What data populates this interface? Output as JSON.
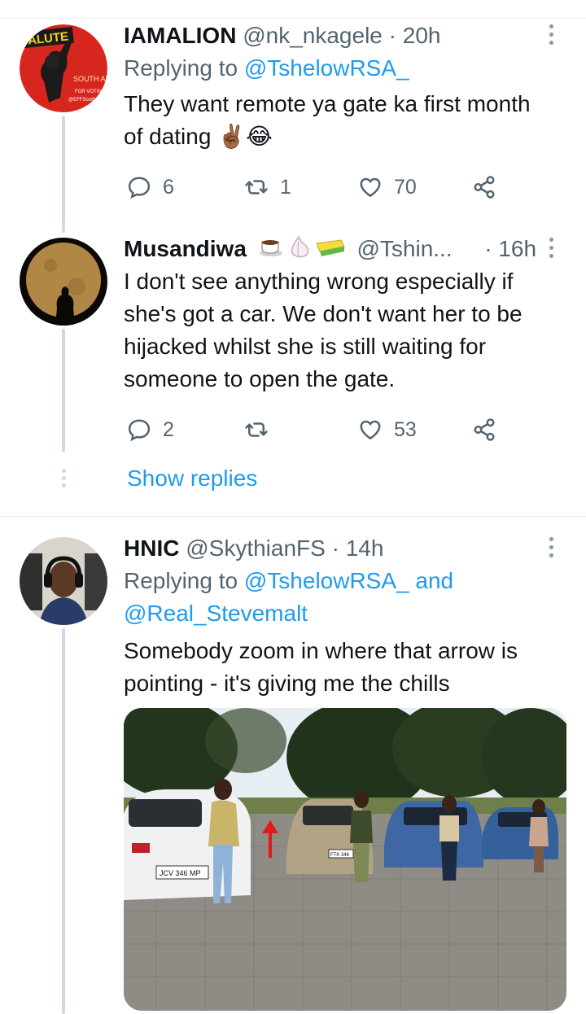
{
  "tweets": [
    {
      "name": "IAMALION",
      "handle": "@nk_nkagele",
      "separator": "·",
      "time": "20h",
      "replying_prefix": "Replying to",
      "replying_to": "@TshelowRSA_",
      "text_lines": [
        "They want remote ya gate ka first month",
        "of dating ✌🏾😂"
      ],
      "avatar_text": {
        "badge": "ALUTE",
        "country": "SOUTH AFRICA",
        "small": "FOR VOTING",
        "tag": "@EFFSouthAfr"
      },
      "actions": {
        "replies": "6",
        "retweets": "1",
        "likes": "70"
      }
    },
    {
      "name": "Musandiwa",
      "emoji_icons": [
        "coffee-icon",
        "garlic-icon",
        "sponge-icon"
      ],
      "handle": "@Tshin...",
      "separator": "·",
      "time": "16h",
      "text_lines": [
        "I don't see anything wrong especially if",
        "she's got a car.  We don't want her to be",
        "hijacked whilst she is still waiting for",
        "someone to open the gate."
      ],
      "actions": {
        "replies": "2",
        "retweets": "",
        "likes": "53"
      }
    },
    {
      "name": "HNIC",
      "handle": "@SkythianFS",
      "separator": "·",
      "time": "14h",
      "replying_prefix": "Replying to",
      "replying_to": "@TshelowRSA_",
      "replying_and": "and",
      "replying_to_2": "@Real_Stevemalt",
      "text_lines": [
        "Somebody zoom in where that arrow is",
        "pointing - it's giving me the chills"
      ],
      "photo": {
        "plate": "JCV 346 MP",
        "plate_2": "FTK 346",
        "description_icon": "parking-lot-photo"
      }
    }
  ],
  "show_replies": "Show replies",
  "colors": {
    "accent": "#1d9bf0",
    "secondary_text": "#536471",
    "divider": "#e6ecf0",
    "thread": "#cfd9de"
  }
}
